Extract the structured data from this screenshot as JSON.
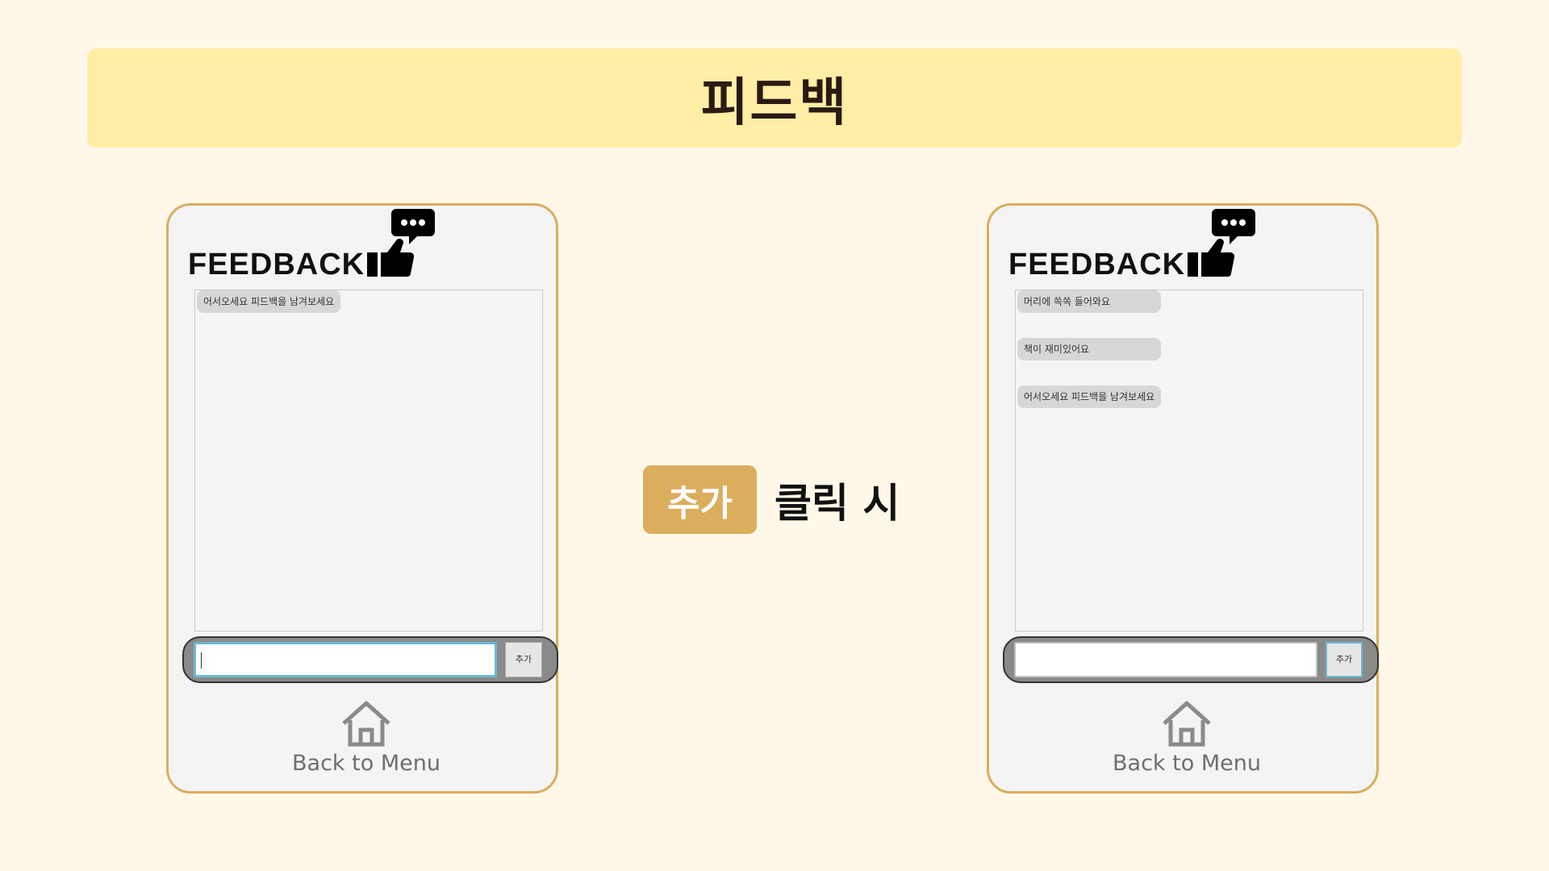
{
  "page": {
    "title": "피드백"
  },
  "left_screen": {
    "header_title": "FEEDBACK",
    "messages": [
      "어서오세요 피드백을 남겨보세요"
    ],
    "input_value": "",
    "add_button_label": "추가",
    "back_label": "Back to Menu"
  },
  "right_screen": {
    "header_title": "FEEDBACK",
    "messages": [
      "머리에 쏙쏙 들어와요",
      "책이 재미있어요",
      "어서오세요 피드백을 남겨보세요"
    ],
    "input_value": "",
    "add_button_label": "추가",
    "back_label": "Back to Menu"
  },
  "transition": {
    "button_label": "추가",
    "caption": "클릭 시"
  },
  "colors": {
    "background": "#FFF8E8",
    "banner": "#FFEEA6",
    "accent": "#DBAE5E",
    "focus": "#6BB9D6"
  },
  "icons": {
    "feedback": "speech-bubble-thumbs-up-icon",
    "home": "home-icon"
  }
}
